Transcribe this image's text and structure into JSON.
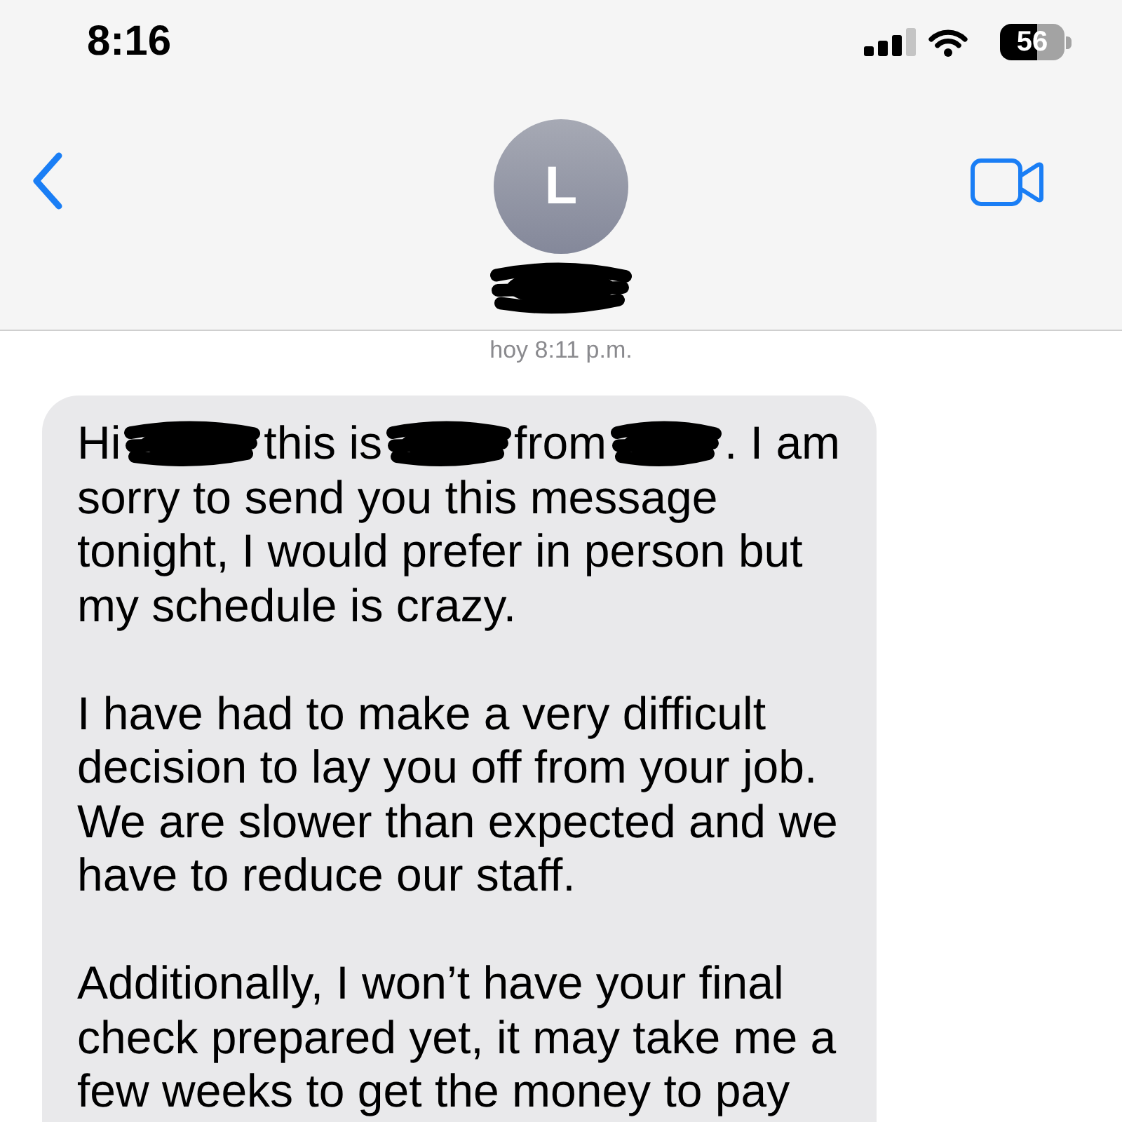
{
  "status_bar": {
    "time": "8:16",
    "battery": "56"
  },
  "contact": {
    "initial": "L",
    "name": {
      "kind": "redaction"
    }
  },
  "timestamp": "hoy 8:11 p.m.",
  "message": {
    "paragraphs": [
      {
        "lead": [
          {
            "kind": "text",
            "text": "Hi"
          },
          {
            "kind": "redaction"
          },
          {
            "kind": "text",
            "text": "this is"
          },
          {
            "kind": "redaction"
          },
          {
            "kind": "text",
            "text": "from"
          },
          {
            "kind": "redaction"
          },
          {
            "kind": "text",
            "text": ". I am"
          }
        ],
        "text": "sorry to send you this message tonight, I would prefer in person but my schedule is crazy."
      },
      {
        "text": "I have had to make a very difficult decision to lay you off from your job. We are slower than expected and we have to reduce our staff."
      },
      {
        "text": "Additionally, I won’t have your final check prepared yet, it may take me a few weeks to get the money to pay"
      }
    ]
  }
}
